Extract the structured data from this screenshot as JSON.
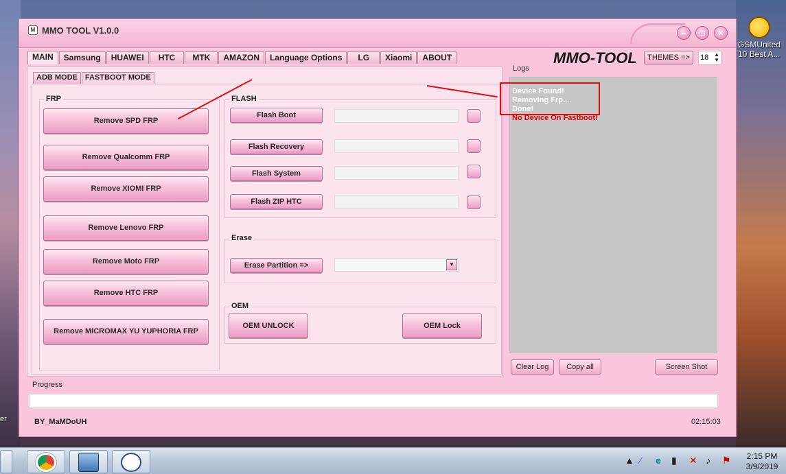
{
  "desktop": {
    "right_icon_label": "GSMUnited 10 Best A...",
    "left_label": "er"
  },
  "window": {
    "title": "MMO TOOL V1.0.0",
    "icon_text": "M",
    "buttons": {
      "minimize": "–",
      "maximize": "□",
      "close": "×"
    }
  },
  "tabs": [
    "MAIN",
    "Samsung",
    "HUAWEI",
    "HTC",
    "MTK",
    "AMAZON",
    "Language Options",
    "LG",
    "Xiaomi",
    "ABOUT"
  ],
  "brand": "MMO-TOOL",
  "themes": {
    "button": "THEMES =>",
    "value": "18"
  },
  "subtabs": [
    "ADB MODE",
    "FASTBOOT MODE"
  ],
  "frp": {
    "title": "FRP",
    "buttons": [
      "Remove SPD FRP",
      "Remove Qualcomm FRP",
      "Remove XIOMI FRP",
      "Remove Lenovo FRP",
      "Remove Moto FRP",
      "Remove HTC FRP",
      "Remove MICROMAX YU YUPHORIA FRP"
    ]
  },
  "flash": {
    "title": "FLASH",
    "buttons": [
      "Flash Boot",
      "Flash Recovery",
      "Flash System",
      "Flash ZIP HTC"
    ]
  },
  "erase": {
    "title": "Erase",
    "button": "Erase Partition =>",
    "selected": ""
  },
  "oem": {
    "title": "OEM",
    "unlock": "OEM UNLOCK",
    "lock": "OEM Lock"
  },
  "logs": {
    "label": "Logs",
    "lines": [
      {
        "text": "Device Found!",
        "color": "#ffffff"
      },
      {
        "text": "Removing Frp....",
        "color": "#ffffff"
      },
      {
        "text": "Done!",
        "color": "#ffffff"
      },
      {
        "text": "No Device On Fastboot!",
        "color": "#e00000"
      }
    ],
    "buttons": {
      "clear": "Clear Log",
      "copy": "Copy all",
      "screenshot": "Screen Shot"
    }
  },
  "progress": {
    "label": "Progress",
    "value": 0
  },
  "footer": {
    "author": "BY_MaMDoUH",
    "time": "02:15:03"
  },
  "taskbar": {
    "clock_time": "2:15 PM",
    "clock_date": "3/9/2019",
    "apps": [
      "chrome-icon",
      "network-computer-icon",
      "mmo-tool-icon"
    ]
  }
}
